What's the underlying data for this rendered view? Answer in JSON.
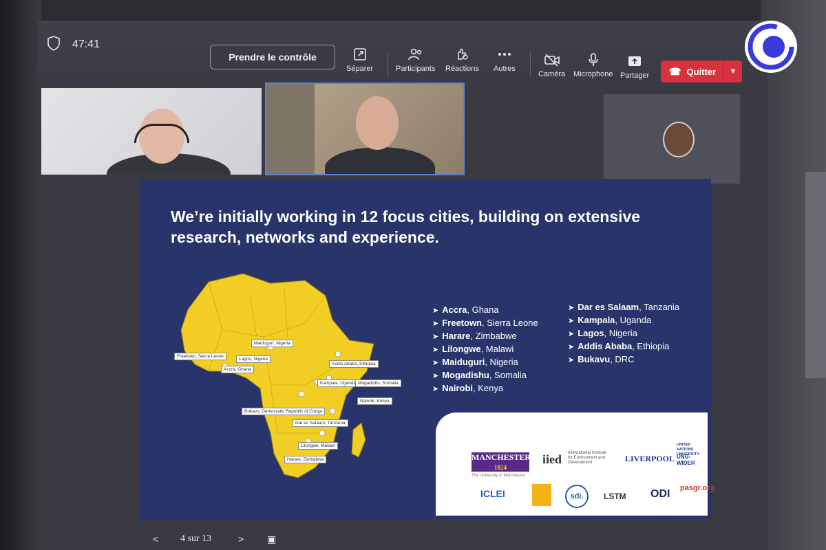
{
  "meeting": {
    "timer": "47:41",
    "take_control": "Prendre le contrôle",
    "tools": [
      {
        "label": "Séparer",
        "icon": "pop-out-icon"
      },
      {
        "label": "Participants",
        "icon": "participants-icon"
      },
      {
        "label": "Réactions",
        "icon": "reactions-icon"
      },
      {
        "label": "Autres",
        "icon": "more-icon"
      },
      {
        "label": "Caméra",
        "icon": "camera-icon"
      },
      {
        "label": "Microphone",
        "icon": "microphone-icon"
      },
      {
        "label": "Partager",
        "icon": "share-icon"
      }
    ],
    "quit": "Quitter"
  },
  "slide": {
    "title": "We’re initially working in 12 focus cities, building on extensive research, networks and experience.",
    "cities_left": [
      {
        "city": "Accra",
        "country": ", Ghana"
      },
      {
        "city": "Freetown",
        "country": ", Sierra Leone"
      },
      {
        "city": "Harare",
        "country": ", Zimbabwe"
      },
      {
        "city": "Lilongwe",
        "country": ", Malawi"
      },
      {
        "city": "Maiduguri",
        "country": ", Nigeria"
      },
      {
        "city": "Mogadishu",
        "country": ", Somalia"
      },
      {
        "city": "Nairobi",
        "country": ", Kenya"
      }
    ],
    "cities_right": [
      {
        "city": "Dar es Salaam",
        "country": ", Tanzania"
      },
      {
        "city": "Kampala",
        "country": ", Uganda"
      },
      {
        "city": "Lagos",
        "country": ", Nigeria"
      },
      {
        "city": "Addis Ababa",
        "country": ", Ethiopia"
      },
      {
        "city": "Bukavu",
        "country": ", DRC"
      }
    ],
    "map_labels": [
      "Freetown, Sierra Leone",
      "Maiduguri, Nigeria",
      "Lagos, Nigeria",
      "Accra, Ghana",
      "Addis Ababa, Ethiopia",
      "Kampala, Uganda",
      "Mogadishu, Somalia",
      "Nairobi, Kenya",
      "Bukavu, Democratic Republic of Congo",
      "Dar es Salaam, Tanzania",
      "Lilongwe, Malawi",
      "Harare, Zimbabwe"
    ],
    "logos": {
      "manchester": "MANCHESTER",
      "manchester_year": "1824",
      "manchester_sub": "The University of Manchester",
      "iied": "iied",
      "iied_sub": "International Institute for Environment and Development",
      "liverpool": "LIVERPOOL",
      "unu": "UNU-WIDER",
      "unu_sub": "UNITED NATIONS UNIVERSITY",
      "iclei": "ICLEI",
      "sdi": "sdi.",
      "lstm": "LSTM",
      "odi": "ODI",
      "pasgr": "pasgr.org"
    }
  },
  "nav": {
    "page": "4 sur 13"
  },
  "colors": {
    "slide_bg": "#28346a",
    "map_fill": "#f2cd24",
    "quit_red": "#d9323f"
  }
}
